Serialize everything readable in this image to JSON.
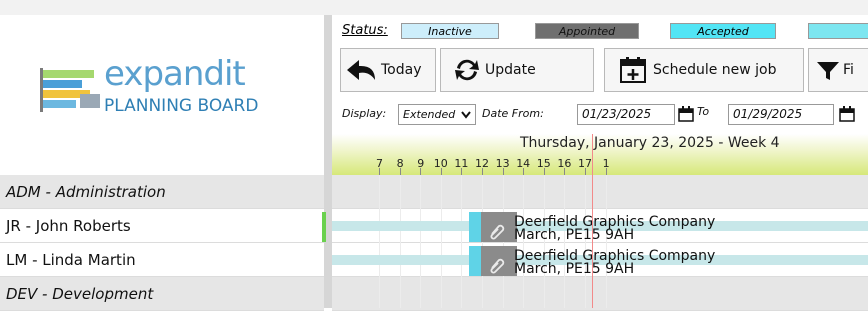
{
  "logo": {
    "line1": "expandit",
    "line2": "PLANNING BOARD"
  },
  "status": {
    "label": "Status:",
    "items": [
      {
        "label": "Inactive",
        "color": "#cdeefb"
      },
      {
        "label": "Appointed",
        "color": "#6f6f6f"
      },
      {
        "label": "Accepted",
        "color": "#52e5f5"
      },
      {
        "label": "",
        "color": "#7de6f0"
      }
    ]
  },
  "toolbar": {
    "today_label": "Today",
    "update_label": "Update",
    "schedule_label": "Schedule new job",
    "filter_label": "Fi"
  },
  "display": {
    "display_label": "Display:",
    "display_value": "Extended",
    "date_from_label": "Date From:",
    "date_from_value": "01/23/2025",
    "to_label": "To",
    "to_value": "01/29/2025"
  },
  "timeline": {
    "date_label": "Thursday, January 23, 2025 - Week 4",
    "hours": [
      "7",
      "8",
      "9",
      "10",
      "11",
      "12",
      "13",
      "14",
      "15",
      "16",
      "17",
      "1"
    ]
  },
  "rows": [
    {
      "label": "ADM - Administration",
      "type": "group"
    },
    {
      "label": "JR - John Roberts",
      "type": "resource"
    },
    {
      "label": "LM - Linda Martin",
      "type": "resource"
    },
    {
      "label": "DEV - Development",
      "type": "group"
    }
  ],
  "jobs": [
    {
      "line1": "Deerfield Graphics Company",
      "line2": "March, PE15 9AH"
    },
    {
      "line1": "Deerfield Graphics Company",
      "line2": "March, PE15 9AH"
    }
  ],
  "colors": {
    "accent_green": "#6ad14e",
    "job_grey": "#8b8b8b",
    "job_border": "#5fd3e7",
    "band": "#c7e7e9",
    "now_line": "#f28a8a"
  }
}
